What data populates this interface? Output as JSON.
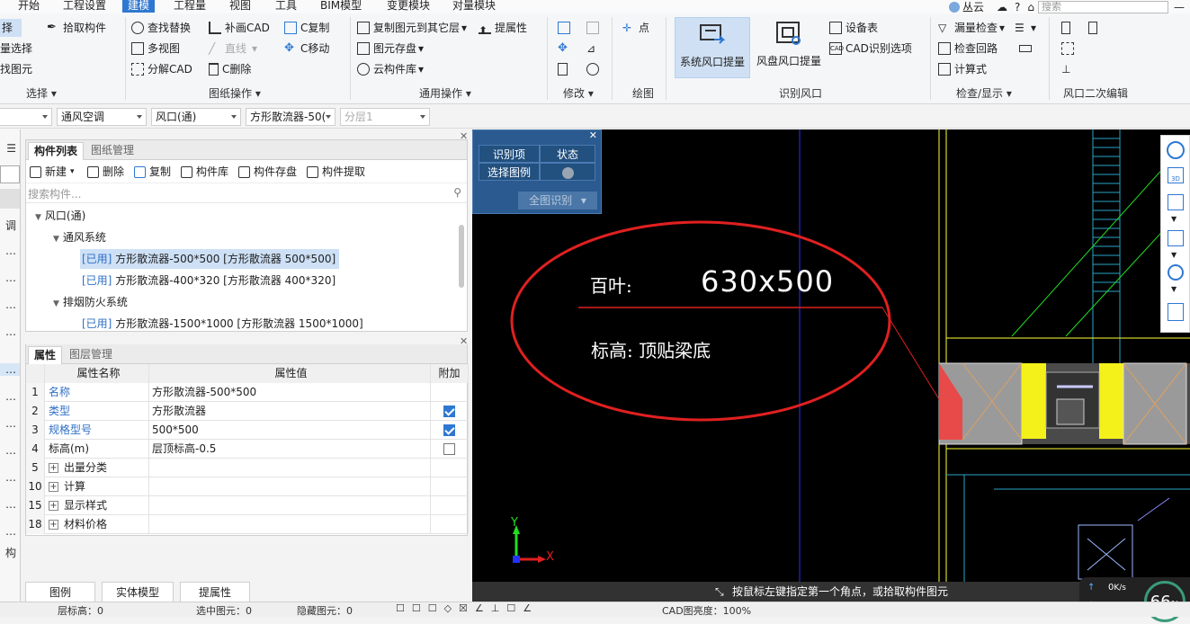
{
  "menubar": {
    "items": [
      "开始",
      "工程设置",
      "建模",
      "工程量",
      "视图",
      "工具",
      "BIM模型",
      "变更模块",
      "对量模块"
    ],
    "active": "建模",
    "user": "丛云",
    "search_placeholder": "搜索"
  },
  "ribbon": {
    "select_group": {
      "label": "选择",
      "items": [
        "择",
        "量选择",
        "找图元"
      ]
    },
    "pick_component": "拾取构件",
    "drawing_ops": {
      "label": "图纸操作",
      "find_replace": "查找替换",
      "multi_view": "多视图",
      "decompose_cad": "分解CAD",
      "patch_cad": "补画CAD",
      "line": "直线",
      "c_delete": "C删除",
      "c_copy": "C复制",
      "c_move": "C移动"
    },
    "general_ops": {
      "label": "通用操作",
      "copy_to_layer": "复制图元到其它层",
      "extract_attr": "提属性",
      "element_save": "图元存盘",
      "cloud_library": "云构件库"
    },
    "modify": {
      "label": "修改"
    },
    "draw": {
      "label": "绘图",
      "point": "点"
    },
    "identify": {
      "label": "识别风口",
      "system_outlet": "系统风口提量",
      "coil_outlet": "风盘风口提量",
      "equipment_table": "设备表",
      "cad_options": "CAD识别选项"
    },
    "check": {
      "label": "检查/显示",
      "leak_check": "漏量检查",
      "check_loop": "检查回路",
      "calc_formula": "计算式"
    },
    "secondary_edit": {
      "label": "风口二次编辑"
    }
  },
  "selector_bar": {
    "combo1": "",
    "combo2": "通风空调",
    "combo3": "风口(通)",
    "combo4": "方形散流器-50(",
    "combo5": "分层1"
  },
  "left_strip": [
    "调",
    "构"
  ],
  "component_panel": {
    "tabs": [
      "构件列表",
      "图纸管理"
    ],
    "toolbar": [
      "新建",
      "删除",
      "复制",
      "构件库",
      "构件存盘",
      "构件提取"
    ],
    "search_placeholder": "搜索构件...",
    "tree": {
      "root": "风口(通)",
      "groups": [
        {
          "name": "通风系统",
          "items": [
            {
              "tag": "[已用]",
              "text": "方形散流器-500*500 [方形散流器 500*500]",
              "selected": true
            },
            {
              "tag": "[已用]",
              "text": "方形散流器-400*320 [方形散流器 400*320]",
              "selected": false
            }
          ]
        },
        {
          "name": "排烟防火系统",
          "items": [
            {
              "tag": "[已用]",
              "text": "方形散流器-1500*1000 [方形散流器 1500*1000]",
              "selected": false
            }
          ]
        }
      ]
    }
  },
  "property_panel": {
    "tabs": [
      "属性",
      "图层管理"
    ],
    "headers": {
      "name": "属性名称",
      "value": "属性值",
      "extra": "附加"
    },
    "rows": [
      {
        "no": "1",
        "name": "名称",
        "value": "方形散流器-500*500",
        "blue": true,
        "check": null
      },
      {
        "no": "2",
        "name": "类型",
        "value": "方形散流器",
        "blue": true,
        "check": true
      },
      {
        "no": "3",
        "name": "规格型号",
        "value": "500*500",
        "blue": true,
        "check": true
      },
      {
        "no": "4",
        "name": "标高(m)",
        "value": "层顶标高-0.5",
        "blue": false,
        "check": false
      },
      {
        "no": "5",
        "name": "出量分类",
        "value": "",
        "blue": false,
        "check": null,
        "expand": true
      },
      {
        "no": "10",
        "name": "计算",
        "value": "",
        "blue": false,
        "check": null,
        "expand": true
      },
      {
        "no": "15",
        "name": "显示样式",
        "value": "",
        "blue": false,
        "check": null,
        "expand": true
      },
      {
        "no": "18",
        "name": "材料价格",
        "value": "",
        "blue": false,
        "check": null,
        "expand": true
      }
    ]
  },
  "bottom_buttons": [
    "图例",
    "实体模型",
    "提属性"
  ],
  "identify_box": {
    "col1": "识别项",
    "col2": "状态",
    "row1": "选择图例",
    "action": "全图识别"
  },
  "canvas": {
    "text_louver_label": "百叶:",
    "text_size": "630x500",
    "text_elevation": "标高: 顶贴梁底",
    "axis_y": "Y",
    "axis_x": "X"
  },
  "status_hint": "按鼠标左键指定第一个角点，或拾取构件图元",
  "speed": {
    "up": "0",
    "down": "0",
    "unit": "K/s",
    "percent": "66",
    "percent_unit": "%"
  },
  "bottom_status": {
    "floor_label": "层标高：0",
    "selected": "选中图元：0",
    "hidden": "隐藏图元：0",
    "cad_brightness": "CAD图亮度：100%"
  },
  "colors": {
    "accent": "#2f78d1",
    "canvas_bg": "#000000",
    "annotation_red": "#e02020",
    "identify_box_bg": "#2a5a8f"
  }
}
